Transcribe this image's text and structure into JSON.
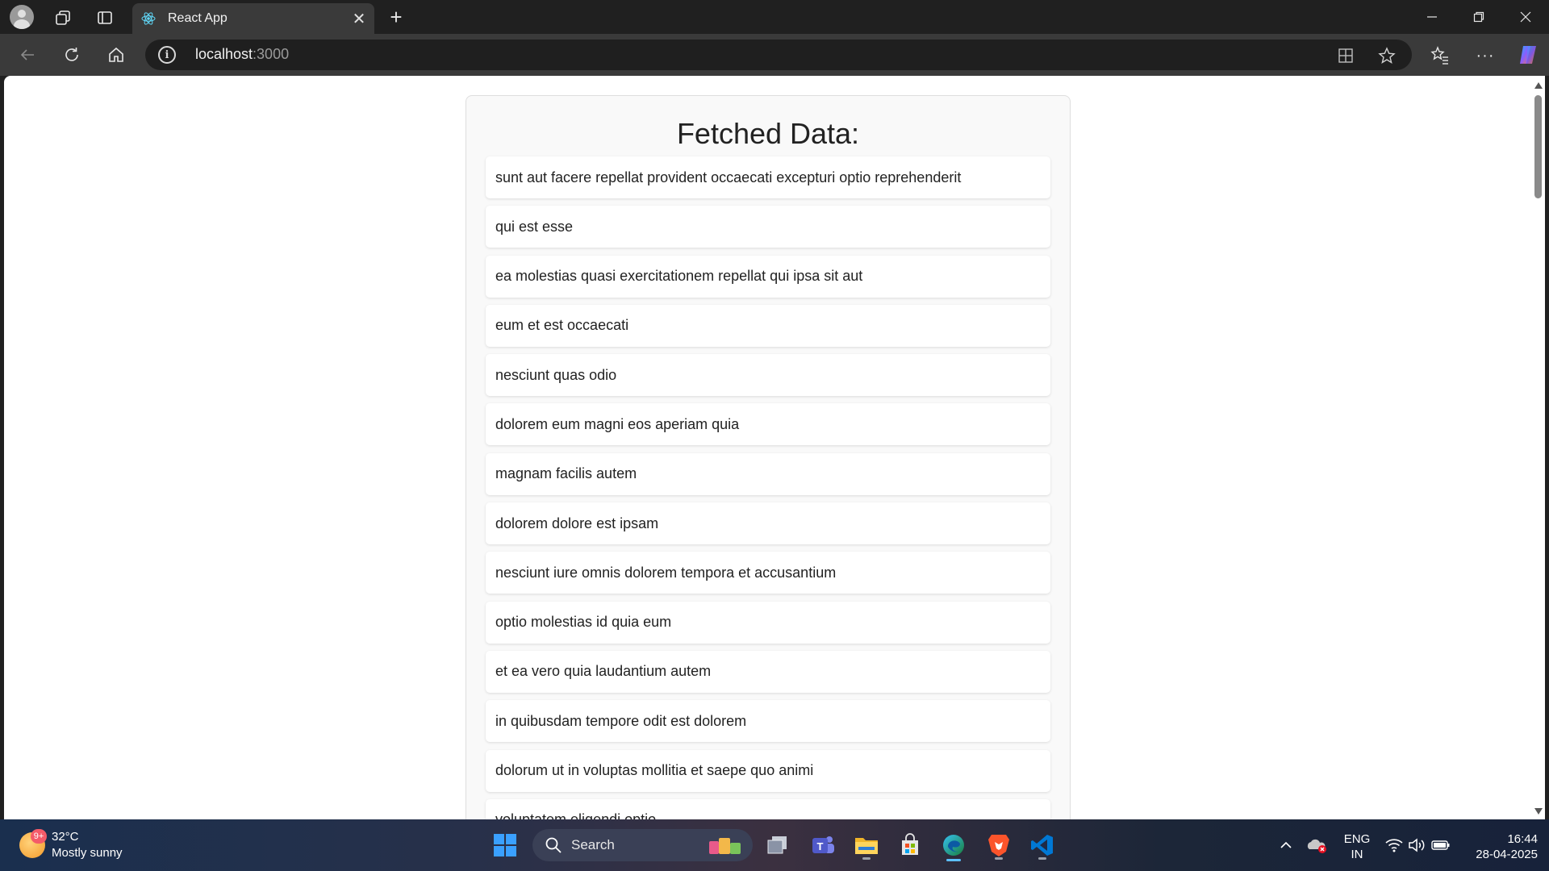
{
  "browser": {
    "tab_title": "React App",
    "address": {
      "host": "localhost",
      "port": ":3000"
    }
  },
  "page": {
    "title": "Fetched Data:",
    "items": [
      "sunt aut facere repellat provident occaecati excepturi optio reprehenderit",
      "qui est esse",
      "ea molestias quasi exercitationem repellat qui ipsa sit aut",
      "eum et est occaecati",
      "nesciunt quas odio",
      "dolorem eum magni eos aperiam quia",
      "magnam facilis autem",
      "dolorem dolore est ipsam",
      "nesciunt iure omnis dolorem tempora et accusantium",
      "optio molestias id quia eum",
      "et ea vero quia laudantium autem",
      "in quibusdam tempore odit est dolorem",
      "dolorum ut in voluptas mollitia et saepe quo animi",
      "voluptatem eligendi optio"
    ]
  },
  "taskbar": {
    "weather": {
      "badge": "9+",
      "temp": "32°C",
      "condition": "Mostly sunny"
    },
    "search_label": "Search",
    "language": {
      "line1": "ENG",
      "line2": "IN"
    },
    "clock": {
      "time": "16:44",
      "date": "28-04-2025"
    }
  }
}
